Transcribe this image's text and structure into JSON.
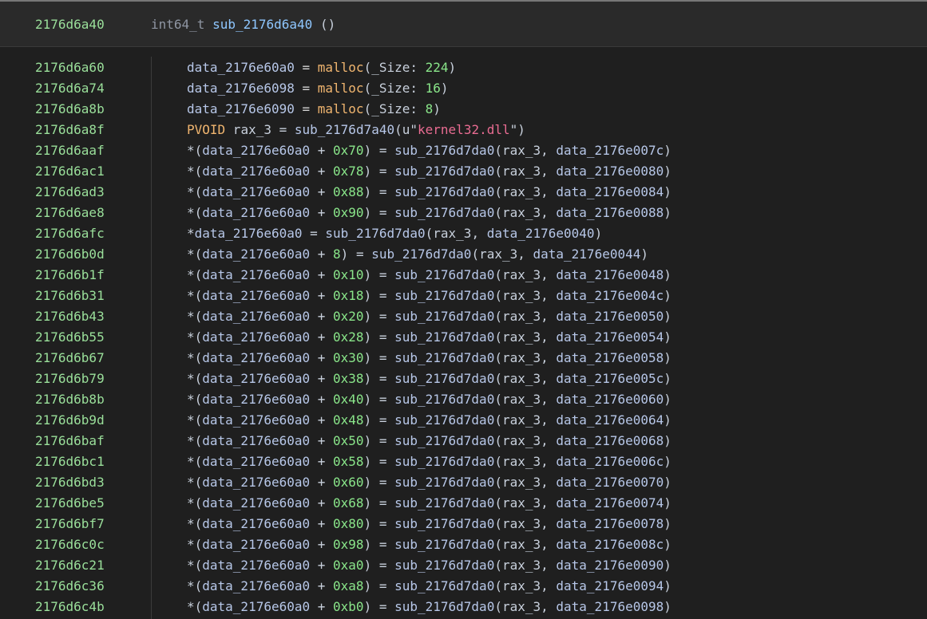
{
  "header": {
    "address": "2176d6a40",
    "return_type": "int64_t",
    "function_name": "sub_2176d6a40",
    "params": "()"
  },
  "rows": [
    {
      "addr": "2176d6a60",
      "tokens": [
        [
          "var",
          "data_2176e60a0"
        ],
        [
          "op",
          " = "
        ],
        [
          "func",
          "malloc"
        ],
        [
          "plain",
          "(_Size: "
        ],
        [
          "num",
          "224"
        ],
        [
          "plain",
          ")"
        ]
      ]
    },
    {
      "addr": "2176d6a74",
      "tokens": [
        [
          "var",
          "data_2176e6098"
        ],
        [
          "op",
          " = "
        ],
        [
          "func",
          "malloc"
        ],
        [
          "plain",
          "(_Size: "
        ],
        [
          "num",
          "16"
        ],
        [
          "plain",
          ")"
        ]
      ]
    },
    {
      "addr": "2176d6a8b",
      "tokens": [
        [
          "var",
          "data_2176e6090"
        ],
        [
          "op",
          " = "
        ],
        [
          "func",
          "malloc"
        ],
        [
          "plain",
          "(_Size: "
        ],
        [
          "num",
          "8"
        ],
        [
          "plain",
          ")"
        ]
      ]
    },
    {
      "addr": "2176d6a8f",
      "tokens": [
        [
          "type",
          "PVOID"
        ],
        [
          "plain",
          " rax_3 = "
        ],
        [
          "var",
          "sub_2176d7a40"
        ],
        [
          "plain",
          "(u\""
        ],
        [
          "str",
          "kernel32.dll"
        ],
        [
          "plain",
          "\")"
        ]
      ]
    },
    {
      "addr": "2176d6aaf",
      "tokens": [
        [
          "plain",
          "*("
        ],
        [
          "var",
          "data_2176e60a0"
        ],
        [
          "plain",
          " + "
        ],
        [
          "num",
          "0x70"
        ],
        [
          "plain",
          ") = "
        ],
        [
          "var",
          "sub_2176d7da0"
        ],
        [
          "plain",
          "(rax_3, "
        ],
        [
          "var",
          "data_2176e007c"
        ],
        [
          "plain",
          ")"
        ]
      ]
    },
    {
      "addr": "2176d6ac1",
      "tokens": [
        [
          "plain",
          "*("
        ],
        [
          "var",
          "data_2176e60a0"
        ],
        [
          "plain",
          " + "
        ],
        [
          "num",
          "0x78"
        ],
        [
          "plain",
          ") = "
        ],
        [
          "var",
          "sub_2176d7da0"
        ],
        [
          "plain",
          "(rax_3, "
        ],
        [
          "var",
          "data_2176e0080"
        ],
        [
          "plain",
          ")"
        ]
      ]
    },
    {
      "addr": "2176d6ad3",
      "tokens": [
        [
          "plain",
          "*("
        ],
        [
          "var",
          "data_2176e60a0"
        ],
        [
          "plain",
          " + "
        ],
        [
          "num",
          "0x88"
        ],
        [
          "plain",
          ") = "
        ],
        [
          "var",
          "sub_2176d7da0"
        ],
        [
          "plain",
          "(rax_3, "
        ],
        [
          "var",
          "data_2176e0084"
        ],
        [
          "plain",
          ")"
        ]
      ]
    },
    {
      "addr": "2176d6ae8",
      "tokens": [
        [
          "plain",
          "*("
        ],
        [
          "var",
          "data_2176e60a0"
        ],
        [
          "plain",
          " + "
        ],
        [
          "num",
          "0x90"
        ],
        [
          "plain",
          ") = "
        ],
        [
          "var",
          "sub_2176d7da0"
        ],
        [
          "plain",
          "(rax_3, "
        ],
        [
          "var",
          "data_2176e0088"
        ],
        [
          "plain",
          ")"
        ]
      ]
    },
    {
      "addr": "2176d6afc",
      "tokens": [
        [
          "plain",
          "*"
        ],
        [
          "var",
          "data_2176e60a0"
        ],
        [
          "plain",
          " = "
        ],
        [
          "var",
          "sub_2176d7da0"
        ],
        [
          "plain",
          "(rax_3, "
        ],
        [
          "var",
          "data_2176e0040"
        ],
        [
          "plain",
          ")"
        ]
      ]
    },
    {
      "addr": "2176d6b0d",
      "tokens": [
        [
          "plain",
          "*("
        ],
        [
          "var",
          "data_2176e60a0"
        ],
        [
          "plain",
          " + "
        ],
        [
          "num",
          "8"
        ],
        [
          "plain",
          ") = "
        ],
        [
          "var",
          "sub_2176d7da0"
        ],
        [
          "plain",
          "(rax_3, "
        ],
        [
          "var",
          "data_2176e0044"
        ],
        [
          "plain",
          ")"
        ]
      ]
    },
    {
      "addr": "2176d6b1f",
      "tokens": [
        [
          "plain",
          "*("
        ],
        [
          "var",
          "data_2176e60a0"
        ],
        [
          "plain",
          " + "
        ],
        [
          "num",
          "0x10"
        ],
        [
          "plain",
          ") = "
        ],
        [
          "var",
          "sub_2176d7da0"
        ],
        [
          "plain",
          "(rax_3, "
        ],
        [
          "var",
          "data_2176e0048"
        ],
        [
          "plain",
          ")"
        ]
      ]
    },
    {
      "addr": "2176d6b31",
      "tokens": [
        [
          "plain",
          "*("
        ],
        [
          "var",
          "data_2176e60a0"
        ],
        [
          "plain",
          " + "
        ],
        [
          "num",
          "0x18"
        ],
        [
          "plain",
          ") = "
        ],
        [
          "var",
          "sub_2176d7da0"
        ],
        [
          "plain",
          "(rax_3, "
        ],
        [
          "var",
          "data_2176e004c"
        ],
        [
          "plain",
          ")"
        ]
      ]
    },
    {
      "addr": "2176d6b43",
      "tokens": [
        [
          "plain",
          "*("
        ],
        [
          "var",
          "data_2176e60a0"
        ],
        [
          "plain",
          " + "
        ],
        [
          "num",
          "0x20"
        ],
        [
          "plain",
          ") = "
        ],
        [
          "var",
          "sub_2176d7da0"
        ],
        [
          "plain",
          "(rax_3, "
        ],
        [
          "var",
          "data_2176e0050"
        ],
        [
          "plain",
          ")"
        ]
      ]
    },
    {
      "addr": "2176d6b55",
      "tokens": [
        [
          "plain",
          "*("
        ],
        [
          "var",
          "data_2176e60a0"
        ],
        [
          "plain",
          " + "
        ],
        [
          "num",
          "0x28"
        ],
        [
          "plain",
          ") = "
        ],
        [
          "var",
          "sub_2176d7da0"
        ],
        [
          "plain",
          "(rax_3, "
        ],
        [
          "var",
          "data_2176e0054"
        ],
        [
          "plain",
          ")"
        ]
      ]
    },
    {
      "addr": "2176d6b67",
      "tokens": [
        [
          "plain",
          "*("
        ],
        [
          "var",
          "data_2176e60a0"
        ],
        [
          "plain",
          " + "
        ],
        [
          "num",
          "0x30"
        ],
        [
          "plain",
          ") = "
        ],
        [
          "var",
          "sub_2176d7da0"
        ],
        [
          "plain",
          "(rax_3, "
        ],
        [
          "var",
          "data_2176e0058"
        ],
        [
          "plain",
          ")"
        ]
      ]
    },
    {
      "addr": "2176d6b79",
      "tokens": [
        [
          "plain",
          "*("
        ],
        [
          "var",
          "data_2176e60a0"
        ],
        [
          "plain",
          " + "
        ],
        [
          "num",
          "0x38"
        ],
        [
          "plain",
          ") = "
        ],
        [
          "var",
          "sub_2176d7da0"
        ],
        [
          "plain",
          "(rax_3, "
        ],
        [
          "var",
          "data_2176e005c"
        ],
        [
          "plain",
          ")"
        ]
      ]
    },
    {
      "addr": "2176d6b8b",
      "tokens": [
        [
          "plain",
          "*("
        ],
        [
          "var",
          "data_2176e60a0"
        ],
        [
          "plain",
          " + "
        ],
        [
          "num",
          "0x40"
        ],
        [
          "plain",
          ") = "
        ],
        [
          "var",
          "sub_2176d7da0"
        ],
        [
          "plain",
          "(rax_3, "
        ],
        [
          "var",
          "data_2176e0060"
        ],
        [
          "plain",
          ")"
        ]
      ]
    },
    {
      "addr": "2176d6b9d",
      "tokens": [
        [
          "plain",
          "*("
        ],
        [
          "var",
          "data_2176e60a0"
        ],
        [
          "plain",
          " + "
        ],
        [
          "num",
          "0x48"
        ],
        [
          "plain",
          ") = "
        ],
        [
          "var",
          "sub_2176d7da0"
        ],
        [
          "plain",
          "(rax_3, "
        ],
        [
          "var",
          "data_2176e0064"
        ],
        [
          "plain",
          ")"
        ]
      ]
    },
    {
      "addr": "2176d6baf",
      "tokens": [
        [
          "plain",
          "*("
        ],
        [
          "var",
          "data_2176e60a0"
        ],
        [
          "plain",
          " + "
        ],
        [
          "num",
          "0x50"
        ],
        [
          "plain",
          ") = "
        ],
        [
          "var",
          "sub_2176d7da0"
        ],
        [
          "plain",
          "(rax_3, "
        ],
        [
          "var",
          "data_2176e0068"
        ],
        [
          "plain",
          ")"
        ]
      ]
    },
    {
      "addr": "2176d6bc1",
      "tokens": [
        [
          "plain",
          "*("
        ],
        [
          "var",
          "data_2176e60a0"
        ],
        [
          "plain",
          " + "
        ],
        [
          "num",
          "0x58"
        ],
        [
          "plain",
          ") = "
        ],
        [
          "var",
          "sub_2176d7da0"
        ],
        [
          "plain",
          "(rax_3, "
        ],
        [
          "var",
          "data_2176e006c"
        ],
        [
          "plain",
          ")"
        ]
      ]
    },
    {
      "addr": "2176d6bd3",
      "tokens": [
        [
          "plain",
          "*("
        ],
        [
          "var",
          "data_2176e60a0"
        ],
        [
          "plain",
          " + "
        ],
        [
          "num",
          "0x60"
        ],
        [
          "plain",
          ") = "
        ],
        [
          "var",
          "sub_2176d7da0"
        ],
        [
          "plain",
          "(rax_3, "
        ],
        [
          "var",
          "data_2176e0070"
        ],
        [
          "plain",
          ")"
        ]
      ]
    },
    {
      "addr": "2176d6be5",
      "tokens": [
        [
          "plain",
          "*("
        ],
        [
          "var",
          "data_2176e60a0"
        ],
        [
          "plain",
          " + "
        ],
        [
          "num",
          "0x68"
        ],
        [
          "plain",
          ") = "
        ],
        [
          "var",
          "sub_2176d7da0"
        ],
        [
          "plain",
          "(rax_3, "
        ],
        [
          "var",
          "data_2176e0074"
        ],
        [
          "plain",
          ")"
        ]
      ]
    },
    {
      "addr": "2176d6bf7",
      "tokens": [
        [
          "plain",
          "*("
        ],
        [
          "var",
          "data_2176e60a0"
        ],
        [
          "plain",
          " + "
        ],
        [
          "num",
          "0x80"
        ],
        [
          "plain",
          ") = "
        ],
        [
          "var",
          "sub_2176d7da0"
        ],
        [
          "plain",
          "(rax_3, "
        ],
        [
          "var",
          "data_2176e0078"
        ],
        [
          "plain",
          ")"
        ]
      ]
    },
    {
      "addr": "2176d6c0c",
      "tokens": [
        [
          "plain",
          "*("
        ],
        [
          "var",
          "data_2176e60a0"
        ],
        [
          "plain",
          " + "
        ],
        [
          "num",
          "0x98"
        ],
        [
          "plain",
          ") = "
        ],
        [
          "var",
          "sub_2176d7da0"
        ],
        [
          "plain",
          "(rax_3, "
        ],
        [
          "var",
          "data_2176e008c"
        ],
        [
          "plain",
          ")"
        ]
      ]
    },
    {
      "addr": "2176d6c21",
      "tokens": [
        [
          "plain",
          "*("
        ],
        [
          "var",
          "data_2176e60a0"
        ],
        [
          "plain",
          " + "
        ],
        [
          "num",
          "0xa0"
        ],
        [
          "plain",
          ") = "
        ],
        [
          "var",
          "sub_2176d7da0"
        ],
        [
          "plain",
          "(rax_3, "
        ],
        [
          "var",
          "data_2176e0090"
        ],
        [
          "plain",
          ")"
        ]
      ]
    },
    {
      "addr": "2176d6c36",
      "tokens": [
        [
          "plain",
          "*("
        ],
        [
          "var",
          "data_2176e60a0"
        ],
        [
          "plain",
          " + "
        ],
        [
          "num",
          "0xa8"
        ],
        [
          "plain",
          ") = "
        ],
        [
          "var",
          "sub_2176d7da0"
        ],
        [
          "plain",
          "(rax_3, "
        ],
        [
          "var",
          "data_2176e0094"
        ],
        [
          "plain",
          ")"
        ]
      ]
    },
    {
      "addr": "2176d6c4b",
      "tokens": [
        [
          "plain",
          "*("
        ],
        [
          "var",
          "data_2176e60a0"
        ],
        [
          "plain",
          " + "
        ],
        [
          "num",
          "0xb0"
        ],
        [
          "plain",
          ") = "
        ],
        [
          "var",
          "sub_2176d7da0"
        ],
        [
          "plain",
          "(rax_3, "
        ],
        [
          "var",
          "data_2176e0098"
        ],
        [
          "plain",
          ")"
        ]
      ]
    }
  ]
}
